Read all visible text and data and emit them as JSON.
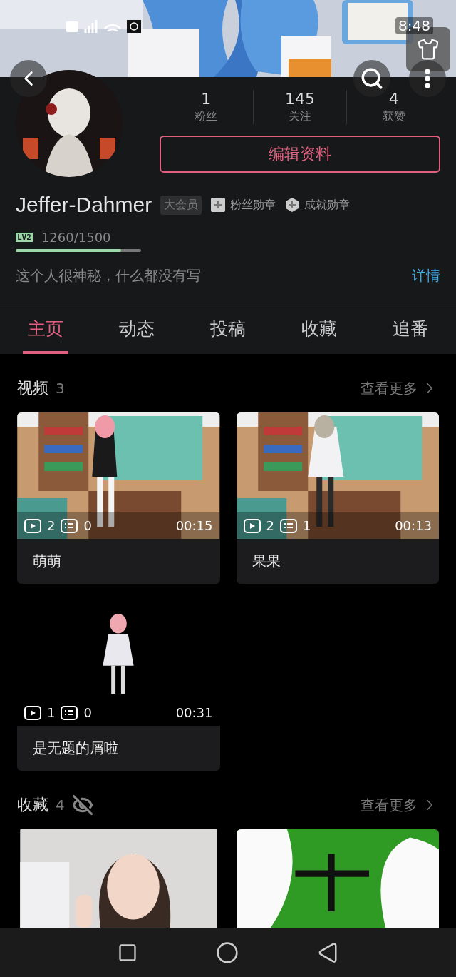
{
  "status_bar": {
    "time": "8:48"
  },
  "profile": {
    "stats": [
      {
        "value": "1",
        "label": "粉丝"
      },
      {
        "value": "145",
        "label": "关注"
      },
      {
        "value": "4",
        "label": "获赞"
      }
    ],
    "edit_button": "编辑资料",
    "username": "Jeffer-Dahmer",
    "vip_badge": "大会员",
    "medals": [
      "粉丝勋章",
      "成就勋章"
    ],
    "level": {
      "badge": "LV2",
      "progress": "1260/1500",
      "level": 0.84
    },
    "bio": "这个人很神秘，什么都没有写",
    "details_link": "详情"
  },
  "tabs": [
    {
      "label": "主页",
      "selected": true
    },
    {
      "label": "动态",
      "selected": false
    },
    {
      "label": "投稿",
      "selected": false
    },
    {
      "label": "收藏",
      "selected": false
    },
    {
      "label": "追番",
      "selected": false
    }
  ],
  "sections": [
    {
      "title": "视频",
      "count": "3",
      "hidden": false,
      "more": "查看更多",
      "items": [
        {
          "kind": "video",
          "title": "萌萌",
          "plays": "2",
          "danmaku": "0",
          "duration": "00:15"
        },
        {
          "kind": "video",
          "title": "果果",
          "plays": "2",
          "danmaku": "1",
          "duration": "00:13"
        },
        {
          "kind": "video",
          "title": "是无题的屑啦",
          "plays": "1",
          "danmaku": "0",
          "duration": "00:31"
        }
      ]
    },
    {
      "title": "收藏",
      "count": "4",
      "hidden": true,
      "more": "查看更多"
    }
  ]
}
